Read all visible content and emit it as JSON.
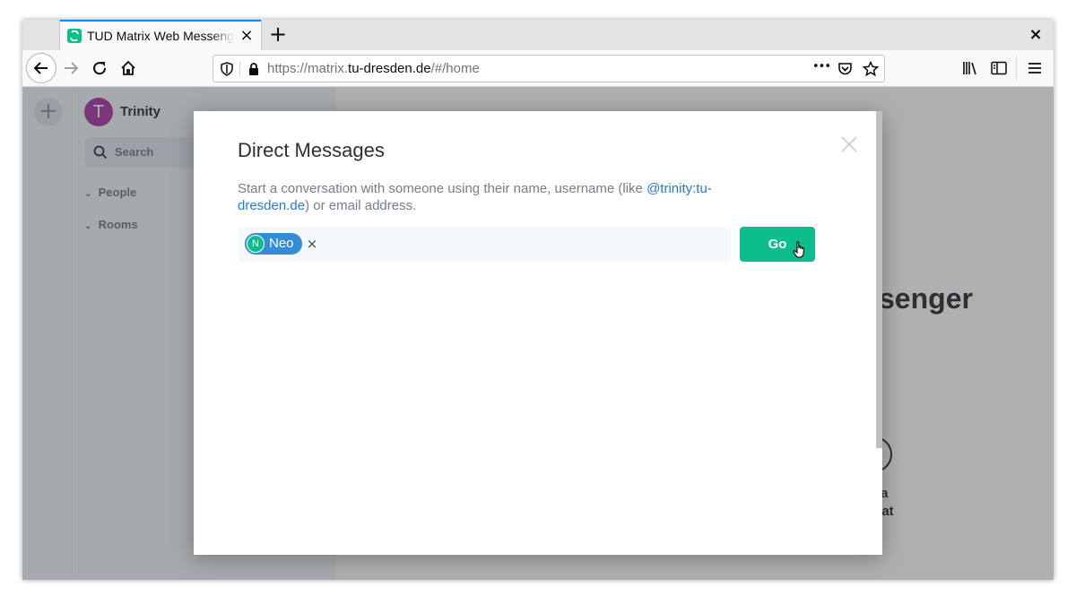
{
  "browser": {
    "tab_title": "TUD Matrix Web Messenger",
    "tab_close": "×",
    "new_tab": "+",
    "window_close": "×",
    "url_prefix": "https://matrix.",
    "url_domain": "tu-dresden.de",
    "url_path": "/#/home",
    "page_actions_glyph": "•••"
  },
  "app": {
    "left_panel": {
      "add_glyph": "+"
    },
    "user": {
      "initial": "T",
      "name": "Trinity",
      "avatar_color": "#ac3ba8"
    },
    "search_placeholder": "Search",
    "sections": [
      {
        "chevron": "⌄",
        "label": "People"
      },
      {
        "chevron": "⌄",
        "label": "Rooms"
      }
    ],
    "home": {
      "title_visible": "senger",
      "action_label_line1": "e a",
      "action_label_line2": "Chat"
    }
  },
  "dialog": {
    "title": "Direct Messages",
    "description_before": "Start a conversation with someone using their name, username (like ",
    "description_link": "@trinity:tu-dresden.de",
    "description_after": ") or email address.",
    "selected_user": {
      "initial": "N",
      "name": "Neo"
    },
    "remove_glyph": "×",
    "go_label": "Go"
  },
  "colors": {
    "accent": "#0dbd8b",
    "pill": "#368bd6",
    "link": "#2a7ac1",
    "firefox_focus": "#0a84ff"
  },
  "icons": [
    "matrix-favicon-icon",
    "back-arrow-icon",
    "forward-arrow-icon",
    "reload-icon",
    "home-icon",
    "shield-icon",
    "lock-icon",
    "pocket-icon",
    "star-icon",
    "library-icon",
    "sidebar-icon",
    "hamburger-menu-icon",
    "search-icon",
    "close-icon",
    "hand-pointer-cursor-icon"
  ]
}
